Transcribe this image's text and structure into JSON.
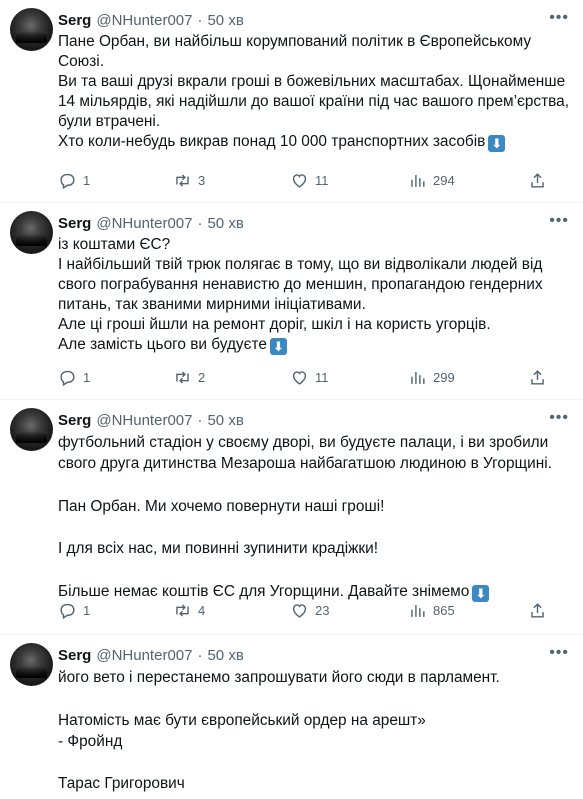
{
  "tweets": [
    {
      "name": "Serg",
      "handle": "@NHunter007",
      "time": "50 хв",
      "text": "Пане Орбан, ви найбільш корумпований політик в Європейському\nСоюзі.\nВи та ваші друзі вкрали гроші в божевільних масштабах. Щонайменше\n14 мільярдів, які надійшли до вашої країни під час вашого прем’єрства,\nбули втрачені.\nХто коли-небудь викрав понад 10 000 транспортних засобів",
      "arrow": "⬇",
      "replies": "1",
      "retweets": "3",
      "likes": "11",
      "views": "294"
    },
    {
      "name": "Serg",
      "handle": "@NHunter007",
      "time": "50 хв",
      "text": "із коштами ЄС?\nІ найбільший твій трюк полягає в тому, що ви відволікали людей від\nсвого пограбування ненавистю до меншин, пропагандою гендерних\nпитань, так званими мирними ініціативами.\nАле ці гроші йшли на ремонт доріг, шкіл і на користь угорців.\nАле замість цього ви будуєте",
      "arrow": "⬇",
      "replies": "1",
      "retweets": "2",
      "likes": "11",
      "views": "299"
    },
    {
      "name": "Serg",
      "handle": "@NHunter007",
      "time": "50 хв",
      "text": "футбольний стадіон у своєму дворі, ви будуєте палаци, і ви зробили\nсвого друга дитинства Мезароша найбагатшою людиною в Угорщині.\n\nПан Орбан. Ми хочемо повернути наші гроші!\n\nІ для всіх нас, ми повинні зупинити крадіжки!\n\nБільше немає коштів ЄС для Угорщини. Давайте знімемо",
      "arrow": "⬇",
      "replies": "1",
      "retweets": "4",
      "likes": "23",
      "views": "865"
    },
    {
      "name": "Serg",
      "handle": "@NHunter007",
      "time": "50 хв",
      "text": "його вето і перестанемо запрошувати його сюди в парламент.\n\nНатомість має бути європейський ордер на арешт»\n- Фройнд\n\nТарас Григорович",
      "arrow": "",
      "replies": "",
      "retweets": "",
      "likes": "",
      "views": ""
    }
  ],
  "icons": {
    "more": "more-icon",
    "reply": "reply-icon",
    "retweet": "retweet-icon",
    "like": "heart-icon",
    "views": "views-icon",
    "share": "share-icon"
  },
  "colors": {
    "text": "#0f1419",
    "secondary": "#536471",
    "divider": "#eff3f4",
    "arrow_emoji": "#3b88c3"
  }
}
